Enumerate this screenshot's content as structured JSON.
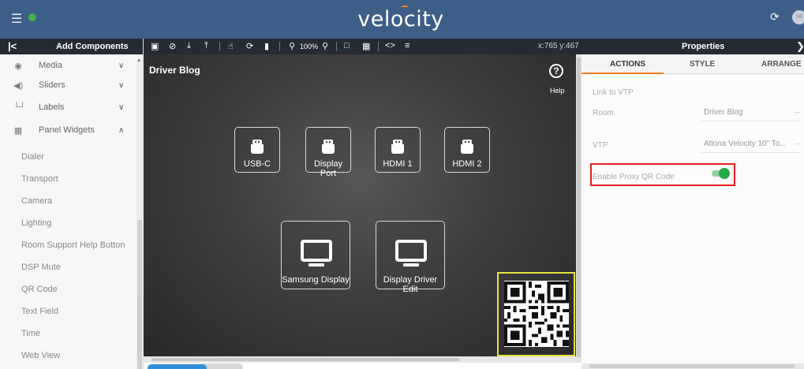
{
  "app": {
    "logo_text": "velocity"
  },
  "header": {
    "menu_icon": "hamburger-icon",
    "refresh_icon": "refresh-icon",
    "avatar_initials": "SE"
  },
  "left_panel": {
    "title": "Add Components",
    "categories": [
      {
        "label": "Media",
        "icon": "play-circle-icon",
        "expanded": false
      },
      {
        "label": "Sliders",
        "icon": "volume-icon",
        "expanded": false
      },
      {
        "label": "Labels",
        "icon": "label-bracket-icon",
        "expanded": false
      },
      {
        "label": "Panel Widgets",
        "icon": "grid-widgets-icon",
        "expanded": true
      }
    ],
    "widgets": [
      "Dialer",
      "Transport",
      "Camera",
      "Lighting",
      "Room Support Help Button",
      "DSP Mute",
      "QR Code",
      "Text Field",
      "Time",
      "Web View"
    ]
  },
  "toolbar": {
    "zoom": "100%",
    "coords": "x:765 y:467"
  },
  "canvas": {
    "title": "Driver Blog",
    "help_label": "Help",
    "small_buttons": [
      "USB-C",
      "Display Port",
      "HDMI 1",
      "HDMI 2"
    ],
    "large_buttons": [
      "Samsung Display",
      "Display Driver Edit"
    ]
  },
  "properties": {
    "title": "Properties",
    "tabs": [
      "ACTIONS",
      "STYLE",
      "ARRANGE"
    ],
    "active_tab": "ACTIONS",
    "link_to_vtp_label": "Link to VTP",
    "room_label": "Room",
    "room_value": "Driver Blog",
    "vtp_label": "VTP",
    "vtp_value": "Atlona Velocity 10\" To...",
    "proxy_qr_label": "Enable Proxy QR Code",
    "proxy_qr_enabled": true
  },
  "colors": {
    "header_bg": "#3d5f87",
    "dark_bar": "#252b33",
    "accent_orange": "#f57f20",
    "toggle_green": "#26a845",
    "highlight_red": "#e02020",
    "qr_frame_yellow": "#e7e43a"
  }
}
